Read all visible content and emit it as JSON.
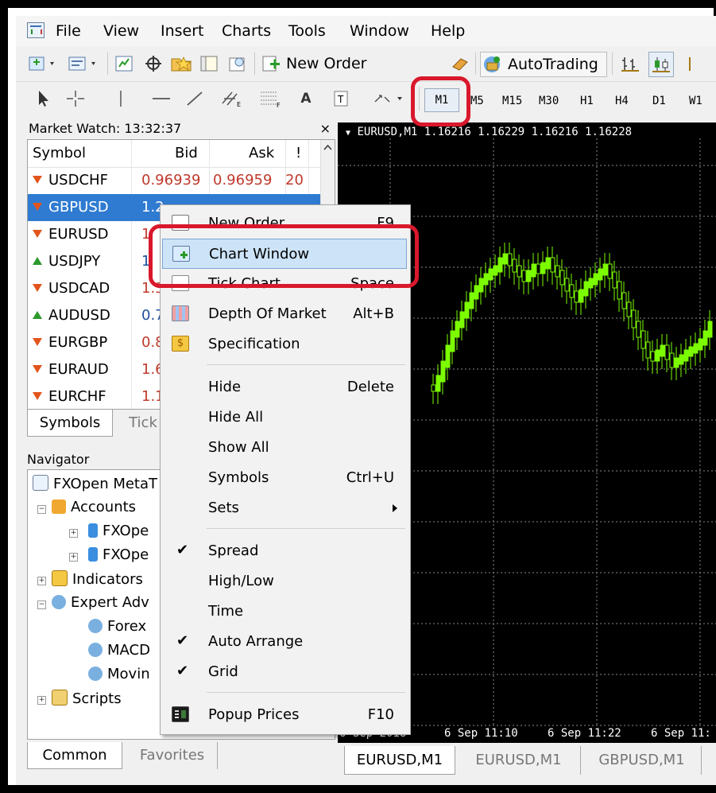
{
  "menubar": {
    "items": [
      "File",
      "View",
      "Insert",
      "Charts",
      "Tools",
      "Window",
      "Help"
    ]
  },
  "toolbar": {
    "new_order_label": "New Order",
    "autotrading_label": "AutoTrading",
    "timeframes": [
      "M1",
      "M5",
      "M15",
      "M30",
      "H1",
      "H4",
      "D1",
      "W1"
    ],
    "selected_timeframe": "M1",
    "text_tool": "A"
  },
  "market_watch": {
    "title": "Market Watch: 13:32:37",
    "close": "×",
    "headers": {
      "symbol": "Symbol",
      "bid": "Bid",
      "ask": "Ask",
      "spread": "!"
    },
    "rows": [
      {
        "symbol": "USDCHF",
        "bid": "0.96939",
        "ask": "0.96959",
        "spread": "20",
        "dir": "down"
      },
      {
        "symbol": "GBPUSD",
        "bid": "1.2",
        "ask": "",
        "spread": "",
        "dir": "down",
        "selected": true
      },
      {
        "symbol": "EURUSD",
        "bid": "1",
        "ask": "",
        "spread": "",
        "dir": "down"
      },
      {
        "symbol": "USDJPY",
        "bid": "1",
        "ask": "",
        "spread": "",
        "dir": "up"
      },
      {
        "symbol": "USDCAD",
        "bid": "1.3",
        "ask": "",
        "spread": "",
        "dir": "down"
      },
      {
        "symbol": "AUDUSD",
        "bid": "0.7",
        "ask": "",
        "spread": "",
        "dir": "up"
      },
      {
        "symbol": "EURGBP",
        "bid": "0.8",
        "ask": "",
        "spread": "",
        "dir": "down"
      },
      {
        "symbol": "EURAUD",
        "bid": "1.6",
        "ask": "",
        "spread": "",
        "dir": "down"
      },
      {
        "symbol": "EURCHF",
        "bid": "1.1",
        "ask": "",
        "spread": "",
        "dir": "down"
      }
    ],
    "tabs": [
      "Symbols",
      "Tick"
    ]
  },
  "navigator": {
    "title": "Navigator",
    "root": "FXOpen MetaT",
    "accounts": "Accounts",
    "account_items": [
      "FXOpe",
      "FXOpe"
    ],
    "indicators": "Indicators",
    "expert_advisors": "Expert Adv",
    "ea_items": [
      "Forex",
      "MACD",
      "Movin"
    ],
    "scripts": "Scripts",
    "tabs": [
      "Common",
      "Favorites"
    ]
  },
  "context_menu": {
    "items": [
      {
        "label": "New Order",
        "shortcut": "F9",
        "icon": "new-order-icon"
      },
      {
        "label": "Chart Window",
        "shortcut": "",
        "icon": "chart-window-icon",
        "highlighted": true
      },
      {
        "label": "Tick Chart",
        "shortcut": "Space",
        "icon": "tick-chart-icon"
      },
      {
        "label": "Depth Of Market",
        "shortcut": "Alt+B",
        "icon": "depth-of-market-icon"
      },
      {
        "label": "Specification",
        "shortcut": "",
        "icon": "specification-icon"
      },
      {
        "label": "Hide",
        "shortcut": "Delete"
      },
      {
        "label": "Hide All",
        "shortcut": ""
      },
      {
        "label": "Show All",
        "shortcut": ""
      },
      {
        "label": "Symbols",
        "shortcut": "Ctrl+U"
      },
      {
        "label": "Sets",
        "shortcut": "",
        "submenu": true
      },
      {
        "label": "Spread",
        "shortcut": "",
        "checked": true
      },
      {
        "label": "High/Low",
        "shortcut": ""
      },
      {
        "label": "Time",
        "shortcut": ""
      },
      {
        "label": "Auto Arrange",
        "shortcut": "",
        "checked": true
      },
      {
        "label": "Grid",
        "shortcut": "",
        "checked": true
      },
      {
        "label": "Popup Prices",
        "shortcut": "F10",
        "icon": "popup-prices-icon"
      }
    ],
    "checkmark": "✔"
  },
  "chart": {
    "title": "EURUSD,M1  1.16216 1.16229 1.16216 1.16228",
    "x_labels": [
      "6 Sep 2018",
      "6 Sep 11:10",
      "6 Sep 11:22",
      "6 Sep 11:"
    ],
    "tabs": [
      "EURUSD,M1",
      "EURUSD,M1",
      "GBPUSD,M1"
    ],
    "colors": {
      "background": "#000000",
      "candle": "#7CFC00",
      "grid": "#8a8a8a"
    }
  },
  "colors": {
    "accent_red": "#d9182c",
    "selection": "#2f7bd1",
    "bid_red": "#c0392b",
    "ask_green": "#b03a2e"
  }
}
